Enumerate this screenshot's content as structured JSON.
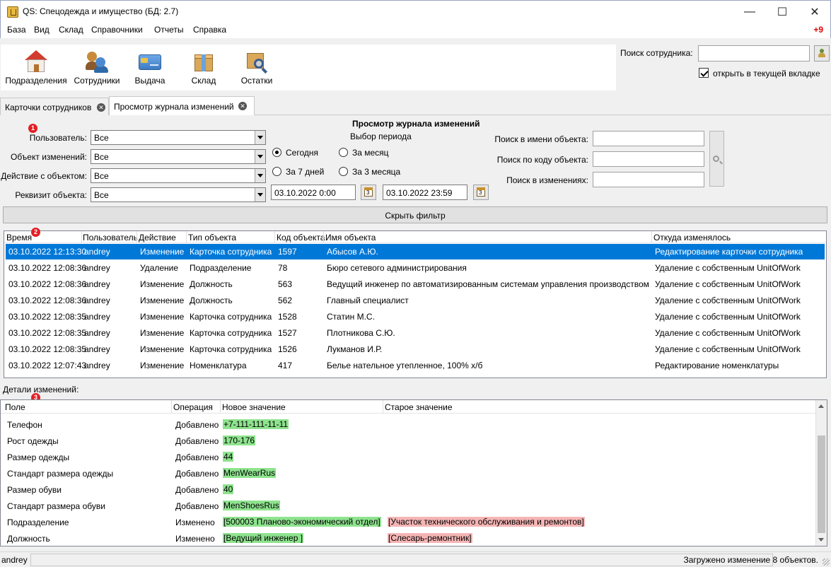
{
  "window": {
    "title": "QS: Спецодежда и имущество (БД: 2.7)"
  },
  "menu": {
    "items": [
      "База",
      "Вид",
      "Склад",
      "Справочники",
      "Отчеты",
      "Справка"
    ],
    "badge": "+9"
  },
  "toolbar": {
    "buttons": [
      {
        "label": "Подразделения",
        "icon": "house-icon"
      },
      {
        "label": "Сотрудники",
        "icon": "users-icon"
      },
      {
        "label": "Выдача",
        "icon": "card-icon"
      },
      {
        "label": "Склад",
        "icon": "box-icon"
      },
      {
        "label": "Остатки",
        "icon": "box-search-icon"
      }
    ]
  },
  "employee_search": {
    "label": "Поиск сотрудника:",
    "value": "",
    "checkbox_label": "открыть в текущей вкладке",
    "checked": true
  },
  "tabs": [
    {
      "label": "Карточки сотрудников",
      "active": false
    },
    {
      "label": "Просмотр журнала изменений",
      "active": true
    }
  ],
  "filter": {
    "markers": [
      "1",
      "2",
      "3"
    ],
    "fields": [
      {
        "label": "Пользователь:",
        "value": "Все"
      },
      {
        "label": "Объект изменений:",
        "value": "Все"
      },
      {
        "label": "Действие с объектом:",
        "value": "Все"
      },
      {
        "label": "Реквизит объекта:",
        "value": "Все"
      }
    ],
    "heading": "Просмотр журнала изменений",
    "period_label": "Выбор периода",
    "periods": [
      {
        "label": "Сегодня",
        "selected": true
      },
      {
        "label": "За месяц",
        "selected": false
      },
      {
        "label": "За 7 дней",
        "selected": false
      },
      {
        "label": "За 3 месяца",
        "selected": false
      }
    ],
    "date_from": "03.10.2022 0:00",
    "date_to": "03.10.2022 23:59",
    "search_fields": [
      {
        "label": "Поиск в имени объекта:",
        "value": ""
      },
      {
        "label": "Поиск по коду объекта:",
        "value": ""
      },
      {
        "label": "Поиск в изменениях:",
        "value": ""
      }
    ],
    "hide_button": "Скрыть фильтр"
  },
  "journal": {
    "columns": [
      "Время",
      "Пользователь",
      "Действие",
      "Тип объекта",
      "Код объекта",
      "Имя объекта",
      "Откуда изменялось"
    ],
    "rows": [
      [
        "03.10.2022 12:13:30",
        "andrey",
        "Изменение",
        "Карточка сотрудника",
        "1597",
        "Абысов А.Ю.",
        "Редактирование карточки сотрудника"
      ],
      [
        "03.10.2022 12:08:36",
        "andrey",
        "Удаление",
        "Подразделение",
        "78",
        "Бюро сетевого администрирования",
        "Удаление с собственным UnitOfWork"
      ],
      [
        "03.10.2022 12:08:36",
        "andrey",
        "Изменение",
        "Должность",
        "563",
        "Ведущий инженер по автоматизированным системам управления производством",
        "Удаление с собственным UnitOfWork"
      ],
      [
        "03.10.2022 12:08:36",
        "andrey",
        "Изменение",
        "Должность",
        "562",
        "Главный специалист",
        "Удаление с собственным UnitOfWork"
      ],
      [
        "03.10.2022 12:08:35",
        "andrey",
        "Изменение",
        "Карточка сотрудника",
        "1528",
        "Статин М.С.",
        "Удаление с собственным UnitOfWork"
      ],
      [
        "03.10.2022 12:08:35",
        "andrey",
        "Изменение",
        "Карточка сотрудника",
        "1527",
        "Плотникова С.Ю.",
        "Удаление с собственным UnitOfWork"
      ],
      [
        "03.10.2022 12:08:35",
        "andrey",
        "Изменение",
        "Карточка сотрудника",
        "1526",
        "Лукманов И.Р.",
        "Удаление с собственным UnitOfWork"
      ],
      [
        "03.10.2022 12:07:43",
        "andrey",
        "Изменение",
        "Номенклатура",
        "417",
        "Белье нательное утепленное, 100% х/б",
        "Редактирование номенклатуры"
      ]
    ],
    "selected_row": 0
  },
  "details": {
    "label": "Детали изменений:",
    "columns": [
      "Поле",
      "Операция",
      "Новое значение",
      "Старое значение"
    ],
    "rows": [
      {
        "field": "Телефон",
        "op": "Добавлено",
        "new": "+7-111-111-11-11",
        "old": ""
      },
      {
        "field": "Рост одежды",
        "op": "Добавлено",
        "new": "170-176",
        "old": ""
      },
      {
        "field": "Размер одежды",
        "op": "Добавлено",
        "new": "44",
        "old": ""
      },
      {
        "field": "Стандарт размера одежды",
        "op": "Добавлено",
        "new": "MenWearRus",
        "old": ""
      },
      {
        "field": "Размер обуви",
        "op": "Добавлено",
        "new": "40",
        "old": ""
      },
      {
        "field": "Стандарт размера обуви",
        "op": "Добавлено",
        "new": "MenShoesRus",
        "old": ""
      },
      {
        "field": "Подразделение",
        "op": "Изменено",
        "new": "[500003 Планово-экономический отдел]",
        "old": "[Участок технического обслуживания и ремонтов]"
      },
      {
        "field": "Должность",
        "op": "Изменено",
        "new": "[Ведущий инженер ]",
        "old": "[Слесарь-ремонтник]"
      }
    ]
  },
  "status": {
    "user": "andrey",
    "message": "Загружено изменение 8 объектов."
  }
}
